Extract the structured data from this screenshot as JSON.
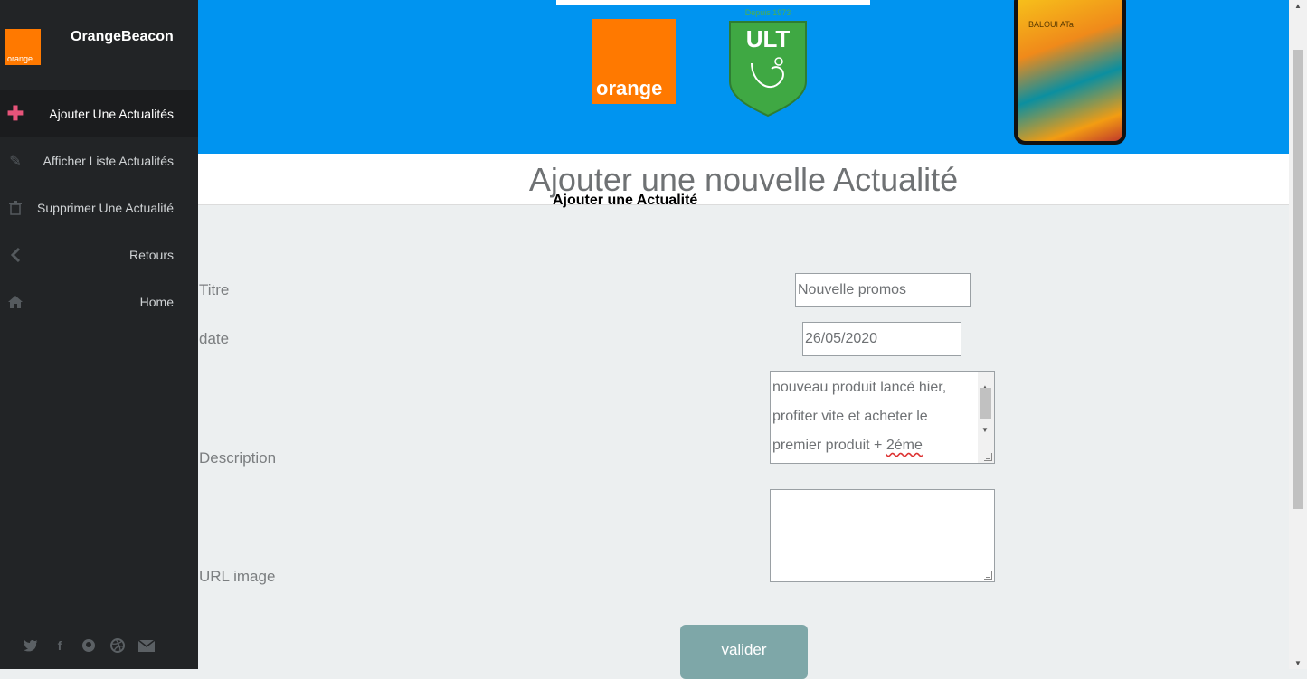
{
  "sidebar": {
    "brand": "OrangeBeacon",
    "logo_text": "orange",
    "items": [
      {
        "label": "Ajouter Une Actualités",
        "icon": "plus-icon",
        "active": true
      },
      {
        "label": "Afficher Liste Actualités",
        "icon": "pencil-icon",
        "active": false
      },
      {
        "label": "Supprimer Une Actualité",
        "icon": "trash-icon",
        "active": false
      },
      {
        "label": "Retours",
        "icon": "chevron-left-icon",
        "active": false
      },
      {
        "label": "Home",
        "icon": "home-icon",
        "active": false
      }
    ],
    "social": [
      "twitter-icon",
      "facebook-icon",
      "github-icon",
      "dribbble-icon",
      "envelope-icon"
    ]
  },
  "banner": {
    "orange_logo_text": "orange",
    "ult_text": "ULT",
    "ult_top_text": "Depuis 1973",
    "phone_text": "BALOUI ATa"
  },
  "page": {
    "title": "Ajouter une nouvelle Actualité",
    "subtitle": "Ajouter une Actualité"
  },
  "form": {
    "titre_label": "Titre",
    "titre_value": "Nouvelle promos",
    "date_label": "date",
    "date_value": "26/05/2020",
    "description_label": "Description",
    "description_lines": [
      "nouveau produit lancé hier,",
      "profiter vite et acheter le",
      "premier produit + "
    ],
    "description_misspelled": "2éme",
    "url_label": "URL image",
    "url_value": "",
    "submit_label": "valider"
  },
  "colors": {
    "sidebar_bg": "#222426",
    "banner_bg": "#0094f0",
    "orange": "#ff7900",
    "button_bg": "#7ea7a8",
    "active_icon": "#e8547a"
  }
}
